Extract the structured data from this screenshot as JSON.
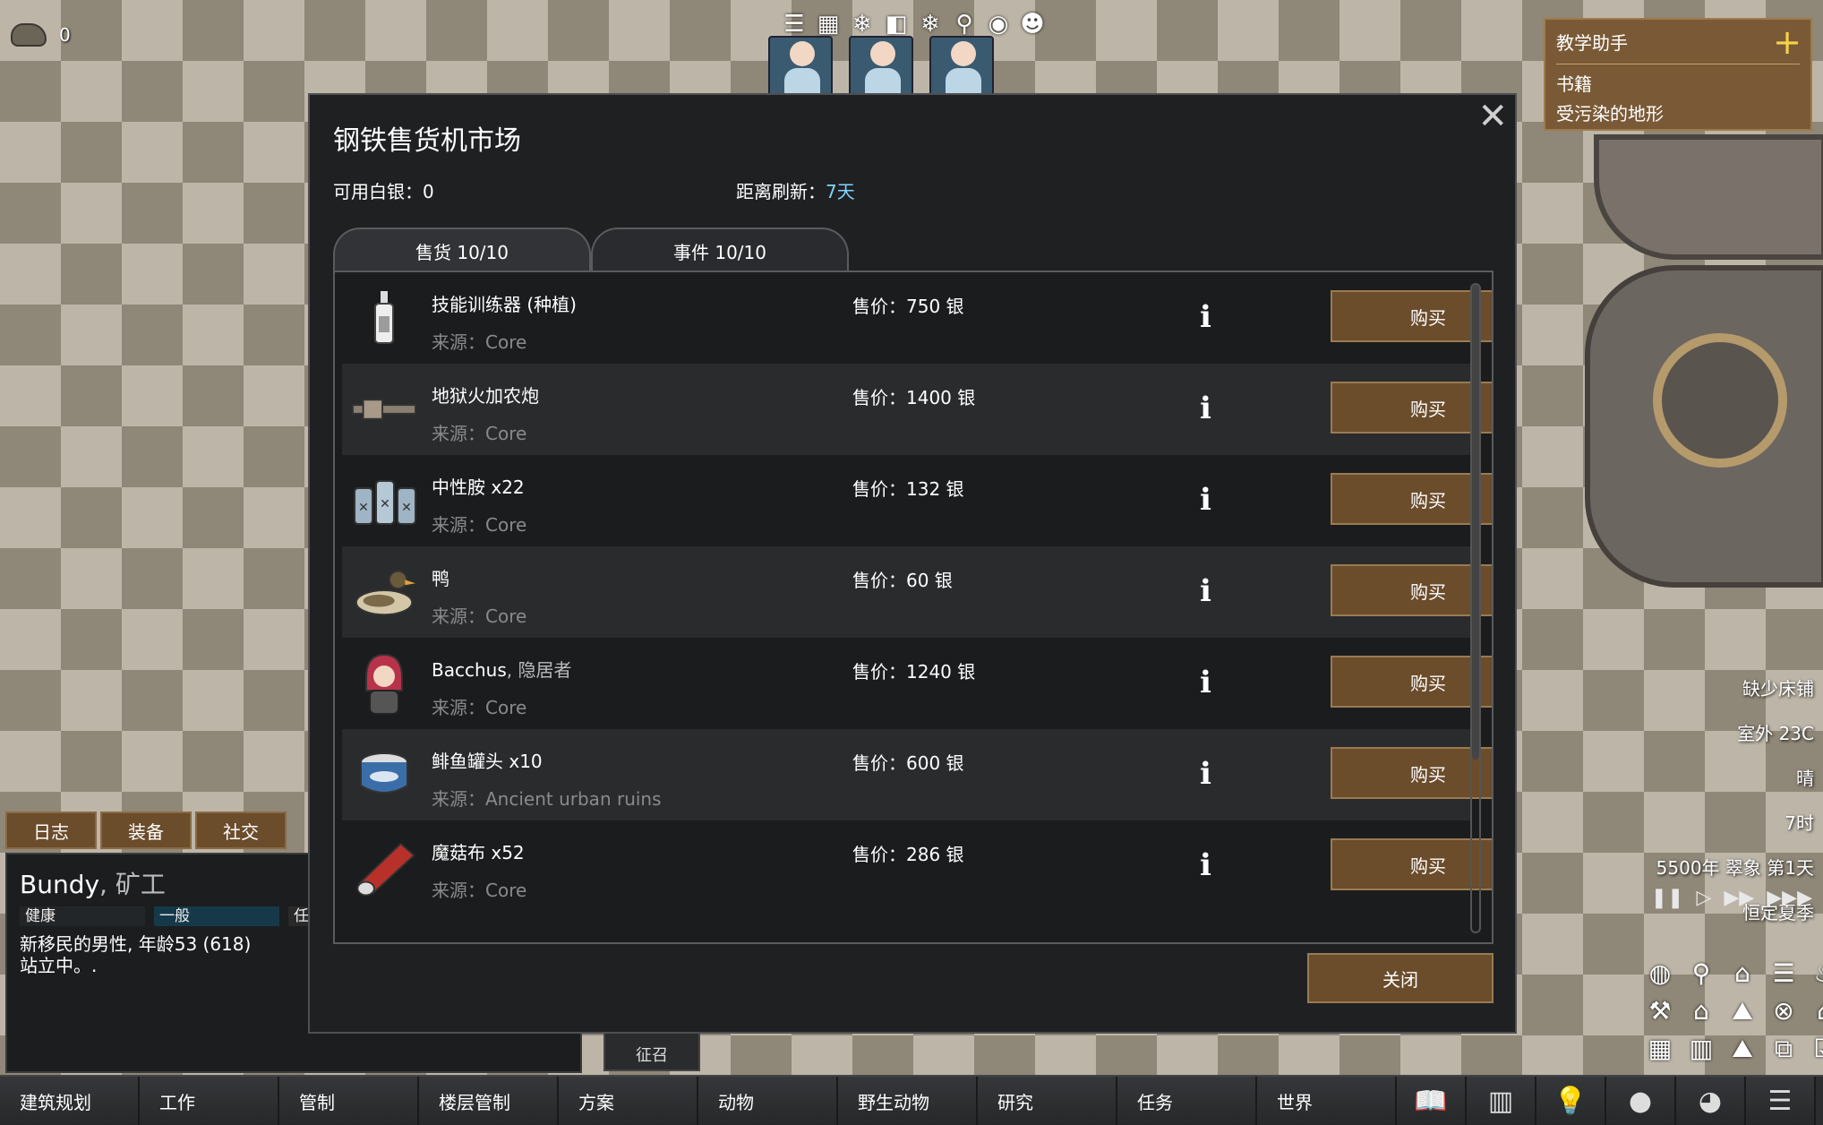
{
  "resource": {
    "icon": "rock-icon",
    "count": "0"
  },
  "top_icons": [
    "list-icon",
    "grid-icon",
    "snowflake-icon",
    "stack-icon",
    "snowflake-icon",
    "magnify-icon",
    "film-icon",
    "face-icon"
  ],
  "tutor": {
    "title": "教学助手",
    "items": [
      "书籍",
      "受污染的地形"
    ]
  },
  "dialog": {
    "title": "钢铁售货机市场",
    "silver": "可用白银：0",
    "refresh_label": "距离刷新：",
    "refresh_value": "7天",
    "tabs": [
      "售货 10/10",
      "事件 10/10"
    ],
    "buy_label": "购买",
    "close_label": "关闭",
    "items": [
      {
        "name": "技能训练器 (种植)",
        "sub": "",
        "source": "来源：Core",
        "price": "售价：750 银",
        "icon": "bottle-icon"
      },
      {
        "name": "地狱火加农炮",
        "sub": "",
        "source": "来源：Core",
        "price": "售价：1400 银",
        "icon": "cannon-icon"
      },
      {
        "name": "中性胺 x22",
        "sub": "",
        "source": "来源：Core",
        "price": "售价：132 银",
        "icon": "medicine-bottles-icon"
      },
      {
        "name": "鸭",
        "sub": "",
        "source": "来源：Core",
        "price": "售价：60 银",
        "icon": "duck-icon"
      },
      {
        "name": "Bacchus",
        "sub": ", 隐居者",
        "source": "来源：Core",
        "price": "售价：1240 银",
        "icon": "pawn-portrait-icon"
      },
      {
        "name": "鲱鱼罐头 x10",
        "sub": "",
        "source": "来源：Ancient urban ruins",
        "price": "售价：600 银",
        "icon": "can-icon"
      },
      {
        "name": "魔菇布 x52",
        "sub": "",
        "source": "来源：Core",
        "price": "售价：286 银",
        "icon": "fabric-roll-icon"
      }
    ]
  },
  "inspect": {
    "tabs": [
      "日志",
      "装备",
      "社交"
    ],
    "name": "Bundy",
    "role": ", 矿工",
    "health": "健康",
    "mood": "一般",
    "third": "任",
    "desc1": "新移民的男性, 年龄53 (618)",
    "desc2": "站立中。."
  },
  "draft_label": "征召",
  "right_info": [
    "缺少床铺",
    "室外 23C",
    "晴",
    "7时",
    "5500年 翠象 第1天",
    "恒定夏季"
  ],
  "bottom_tabs": [
    "建筑规划",
    "工作",
    "管制",
    "楼层管制",
    "方案",
    "动物",
    "野生动物",
    "研究",
    "任务",
    "世界"
  ],
  "bottom_icons": [
    "book-icon",
    "chart-icon",
    "lightbulb-icon",
    "head-icon",
    "portrait-icon",
    "menu-icon"
  ]
}
